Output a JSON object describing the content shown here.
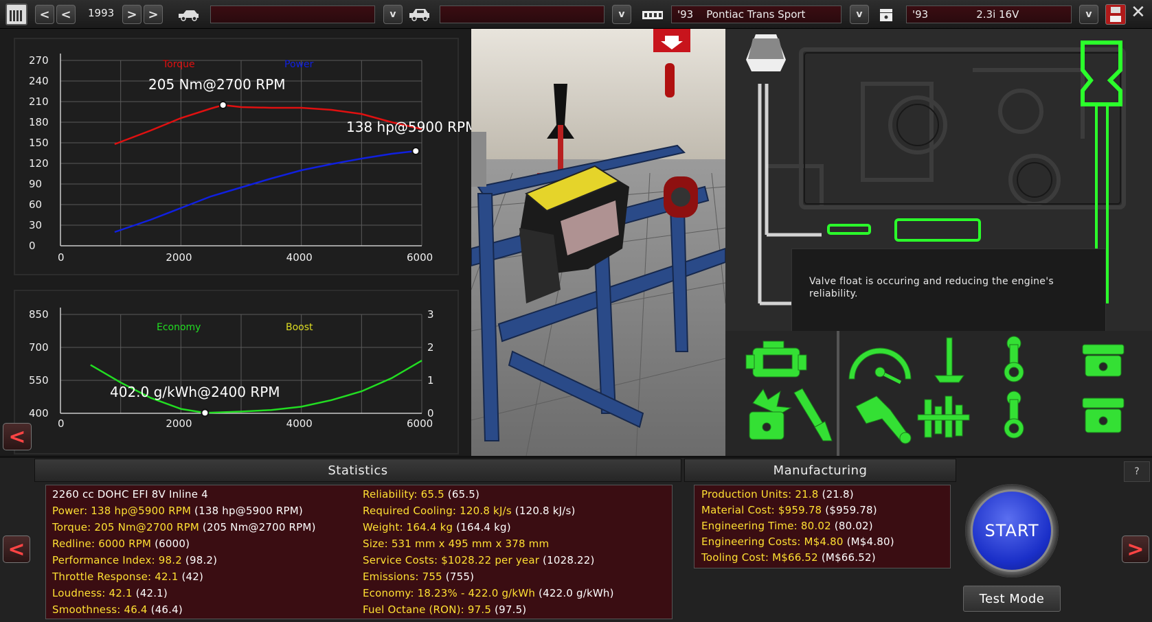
{
  "topbar": {
    "year": "1993",
    "model_family_value": "",
    "trim_value": "",
    "car_year_prefix": "'93",
    "car_name": "Pontiac Trans Sport",
    "engine_year_prefix": "'93",
    "engine_name": "2.3i 16V",
    "prev_label": "<",
    "next_label": ">",
    "dropdown_label": "v"
  },
  "power_graph": {
    "legend_torque": "Torque",
    "legend_power": "Power",
    "torque_annotation": "205 Nm@2700 RPM",
    "power_annotation": "138 hp@5900 RPM",
    "y_ticks": [
      "270",
      "240",
      "210",
      "180",
      "150",
      "120",
      "90",
      "60",
      "30",
      "0"
    ],
    "x_ticks": [
      "0",
      "2000",
      "4000",
      "6000"
    ],
    "colors": {
      "torque": "#e01010",
      "power": "#1020e0"
    }
  },
  "economy_graph": {
    "legend_economy": "Economy",
    "legend_boost": "Boost",
    "economy_annotation": "402.0 g/kWh@2400 RPM",
    "y_ticks_left": [
      "850",
      "700",
      "550",
      "400"
    ],
    "y_ticks_right": [
      "3",
      "2",
      "1",
      "0"
    ],
    "x_ticks": [
      "0",
      "2000",
      "4000",
      "6000"
    ],
    "colors": {
      "economy": "#22dd22",
      "boost": "#dddd22"
    }
  },
  "chart_data": [
    {
      "type": "line",
      "xlim": [
        0,
        6000
      ],
      "ylim": [
        0,
        270
      ],
      "series": [
        {
          "name": "Torque",
          "x": [
            900,
            1500,
            2000,
            2500,
            2700,
            3000,
            3500,
            4000,
            4500,
            5000,
            5500,
            6000
          ],
          "values": [
            148,
            168,
            186,
            200,
            205,
            202,
            201,
            201,
            198,
            192,
            180,
            170
          ]
        },
        {
          "name": "Power",
          "x": [
            900,
            1500,
            2000,
            2500,
            3000,
            3500,
            4000,
            4500,
            5000,
            5500,
            5900
          ],
          "values": [
            20,
            38,
            55,
            72,
            85,
            98,
            110,
            119,
            127,
            134,
            138
          ]
        }
      ]
    },
    {
      "type": "line",
      "xlim": [
        0,
        6000
      ],
      "ylim": [
        400,
        850
      ],
      "y2lim": [
        0,
        3
      ],
      "series": [
        {
          "name": "Economy",
          "x": [
            500,
            1000,
            1500,
            2000,
            2400,
            3000,
            3500,
            4000,
            4500,
            5000,
            5500,
            6000
          ],
          "values": [
            620,
            540,
            470,
            420,
            402,
            408,
            415,
            430,
            460,
            500,
            560,
            640
          ]
        }
      ]
    }
  ],
  "tooltip": {
    "text": "Valve float is occuring and reducing the engine's reliability."
  },
  "statistics": {
    "header": "Statistics",
    "left": [
      {
        "label": "2260 cc DOHC EFI 8V Inline 4",
        "value": ""
      },
      {
        "label": "Power: 138 hp@5900 RPM",
        "value": "(138 hp@5900 RPM)"
      },
      {
        "label": "Torque: 205 Nm@2700 RPM",
        "value": "(205 Nm@2700 RPM)"
      },
      {
        "label": "Redline: 6000 RPM",
        "value": "(6000)"
      },
      {
        "label": "Performance Index: 98.2",
        "value": "(98.2)"
      },
      {
        "label": "Throttle Response: 42.1",
        "value": "(42)"
      },
      {
        "label": "Loudness: 42.1",
        "value": "(42.1)"
      },
      {
        "label": "Smoothness: 46.4",
        "value": "(46.4)"
      }
    ],
    "right": [
      {
        "label": "Reliability: 65.5",
        "value": "(65.5)"
      },
      {
        "label": "Required Cooling: 120.8 kJ/s",
        "value": "(120.8 kJ/s)"
      },
      {
        "label": "Weight: 164.4 kg",
        "value": "(164.4 kg)"
      },
      {
        "label": "Size: 531 mm x 495 mm x 378 mm",
        "value": ""
      },
      {
        "label": "Service Costs: $1028.22 per year",
        "value": "(1028.22)"
      },
      {
        "label": "Emissions: 755",
        "value": "(755)"
      },
      {
        "label": "Economy: 18.23% - 422.0 g/kWh",
        "value": "(422.0 g/kWh)"
      },
      {
        "label": "Fuel Octane (RON): 97.5",
        "value": "(97.5)"
      }
    ]
  },
  "manufacturing": {
    "header": "Manufacturing",
    "lines": [
      {
        "label": "Production Units: 21.8",
        "value": "(21.8)"
      },
      {
        "label": "Material Cost: $959.78",
        "value": "($959.78)"
      },
      {
        "label": "Engineering Time: 80.02",
        "value": "(80.02)"
      },
      {
        "label": "Engineering Costs: M$4.80",
        "value": "(M$4.80)"
      },
      {
        "label": "Tooling Cost: M$66.52",
        "value": "(M$66.52)"
      }
    ]
  },
  "actions": {
    "start_label": "START",
    "test_mode_label": "Test Mode",
    "help_label": "?",
    "nav_prev": "<",
    "nav_next": ">"
  }
}
